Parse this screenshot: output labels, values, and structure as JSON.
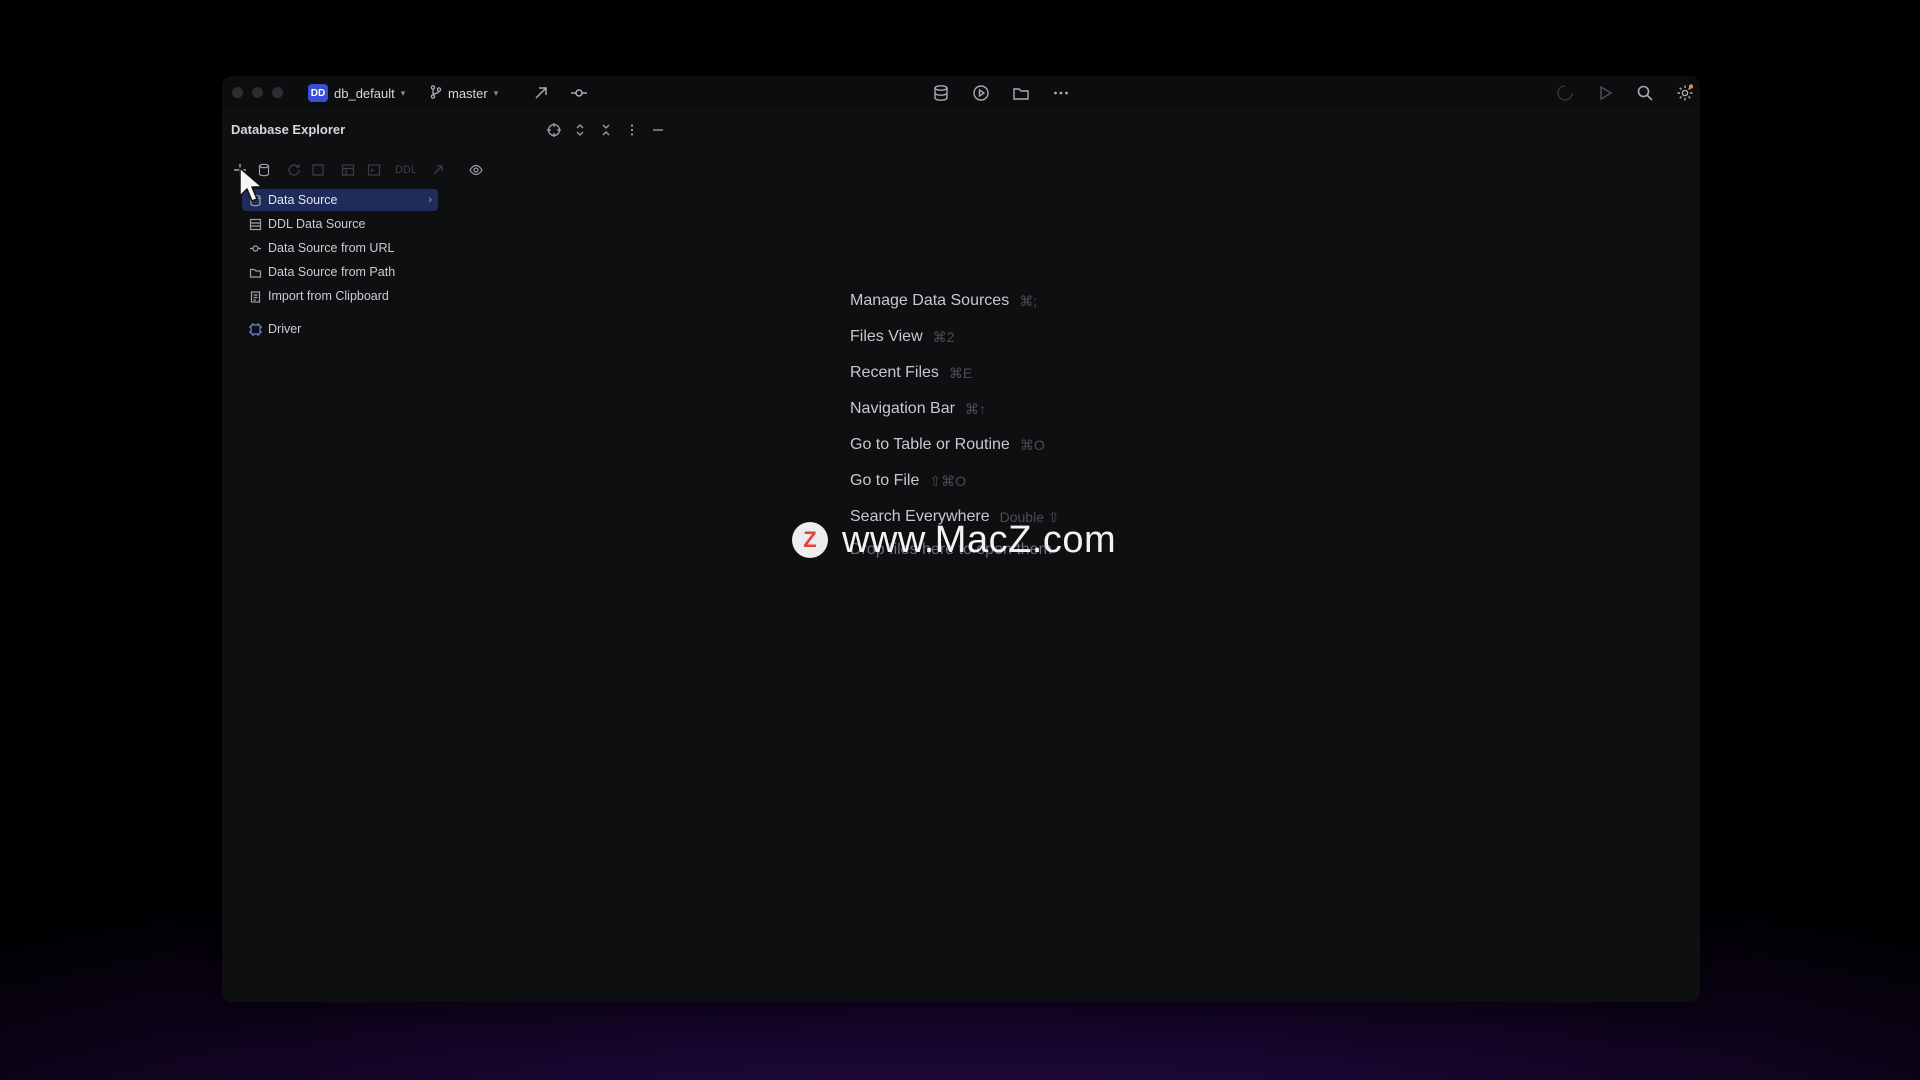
{
  "titlebar": {
    "project_badge": "DD",
    "project_name": "db_default",
    "branch_name": "master"
  },
  "panel": {
    "title": "Database Explorer"
  },
  "toolbar": {
    "ddl_label": "DDL"
  },
  "menu": {
    "items": [
      {
        "label": "Data Source",
        "icon": "database-icon",
        "has_submenu": true
      },
      {
        "label": "DDL Data Source",
        "icon": "ddl-icon"
      },
      {
        "label": "Data Source from URL",
        "icon": "url-icon"
      },
      {
        "label": "Data Source from Path",
        "icon": "folder-icon"
      },
      {
        "label": "Import from Clipboard",
        "icon": "clipboard-icon"
      },
      {
        "label": "Driver",
        "icon": "driver-icon"
      }
    ],
    "submenu_arrow": "›"
  },
  "shortcuts": [
    {
      "label": "Manage Data Sources",
      "key": "⌘;"
    },
    {
      "label": "Files View",
      "key": "⌘2"
    },
    {
      "label": "Recent Files",
      "key": "⌘E"
    },
    {
      "label": "Navigation Bar",
      "key": "⌘↑"
    },
    {
      "label": "Go to Table or Routine",
      "key": "⌘O"
    },
    {
      "label": "Go to File",
      "key": "⇧⌘O"
    },
    {
      "label": "Search Everywhere",
      "key": "Double ⇧"
    }
  ],
  "drop_hint": "Drop files here to open them",
  "watermark": {
    "badge": "Z",
    "text": "www.MacZ.com"
  },
  "colors": {
    "accent": "#3a4fd6",
    "selection": "#1f2c5b",
    "notification_dot": "#e8893a"
  }
}
